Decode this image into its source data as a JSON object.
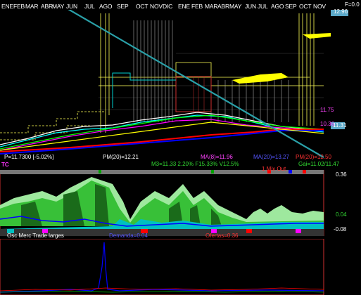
{
  "header": {
    "months": [
      "ENE",
      "FEB",
      "MAR",
      "ABR",
      "MAY",
      "JUN",
      "JUL",
      "AGO",
      "SEP",
      "OCT",
      "NOV",
      "DIC",
      "ENE",
      "FEB",
      "MAR",
      "ABR",
      "MAY",
      "JUN",
      "JUL",
      "AGO",
      "SEP",
      "OCT",
      "NOV"
    ],
    "f_value": "F=0.0"
  },
  "price_panel": {
    "price_top": "12.96",
    "price_mid": "11.75",
    "price_last": "11.31",
    "price_low": "10.36",
    "readout_left": "P=11.7300 [-5.02%]",
    "pm20": "PM(20)=12.21",
    "ma20": "MA(20)=13.27",
    "pm": "PM(20)=12.50",
    "ma8": "MA(8)=11.96",
    "stats_line": "M3=11.33  2.20%  F15.33%  V12.5%",
    "gai": "Gai=11.02/11.47"
  },
  "tc_panel": {
    "label": "TC",
    "mix_label": "1 Mix Out",
    "scale_top": "0.36",
    "scale_mid": "0.04",
    "scale_bottom": "-0.08"
  },
  "osc_panel": {
    "title": "Osc Merc Trade larges",
    "demand_label": "Demanda=0.04",
    "offer_label": "Ofertas=0.36"
  },
  "colors": {
    "green_dark": "#1a6b1a",
    "green_bright": "#38c038",
    "green_light": "#9ee89e",
    "cyan": "#00c0c0",
    "blue": "#0000ff",
    "red": "#e00000",
    "teal_line": "#2aa0a8"
  }
}
